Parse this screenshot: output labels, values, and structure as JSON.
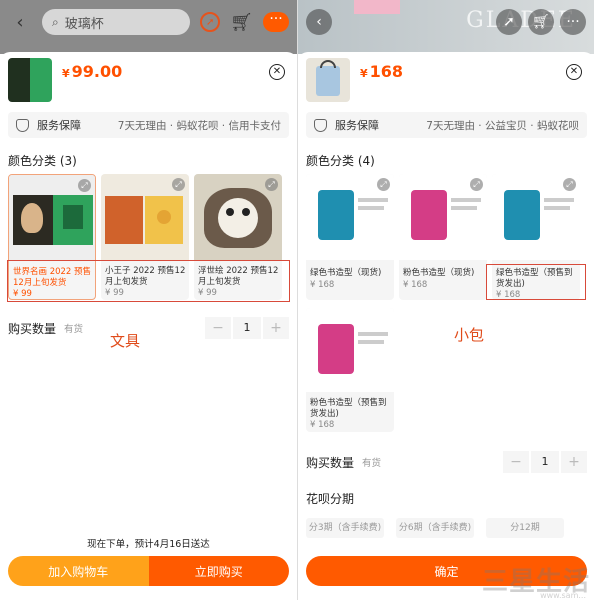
{
  "left": {
    "search_text": "玻璃杯",
    "price_symbol": "¥",
    "price": "99.00",
    "service_label": "服务保障",
    "service_detail": "7天无理由 · 蚂蚁花呗 · 信用卡支付",
    "category_title": "颜色分类 (3)",
    "options": [
      {
        "name": "世界名画 2022 预售12月上旬发货",
        "price": "¥ 99",
        "selected": true
      },
      {
        "name": "小王子 2022 预售12月上旬发货",
        "price": "¥ 99",
        "selected": false
      },
      {
        "name": "浮世绘 2022 预售12月上旬发货",
        "price": "¥ 99",
        "selected": false
      }
    ],
    "qty_label": "购买数量",
    "stock": "有货",
    "qty_minus": "−",
    "qty_value": "1",
    "qty_plus": "+",
    "overlay_label": "文具",
    "delivery_text": "现在下单，预计4月16日送达",
    "add_cart_label": "加入购物车",
    "buy_now_label": "立即购买"
  },
  "right": {
    "banner_brand": "GLADEE",
    "price_symbol": "¥",
    "price": "168",
    "service_label": "服务保障",
    "service_detail": "7天无理由 · 公益宝贝 · 蚂蚁花呗",
    "category_title": "颜色分类 (4)",
    "options": [
      {
        "name": "绿色书造型（现货)",
        "price": "¥ 168",
        "selected": false,
        "color": "#1f8fb0"
      },
      {
        "name": "粉色书造型（现货)",
        "price": "¥ 168",
        "selected": false,
        "color": "#d43d86"
      },
      {
        "name": "绿色书造型（预售到货发出)",
        "price": "¥ 168",
        "selected": true,
        "color": "#1f8fb0"
      },
      {
        "name": "粉色书造型（预售到货发出)",
        "price": "¥ 168",
        "selected": false,
        "color": "#d43d86"
      }
    ],
    "qty_label": "购买数量",
    "stock": "有货",
    "qty_minus": "−",
    "qty_value": "1",
    "qty_plus": "+",
    "overlay_label": "小包",
    "installment_title": "花呗分期",
    "installments": [
      "分3期（含手续费)",
      "分6期（含手续费)",
      "分12期"
    ],
    "confirm_label": "确定",
    "watermark": "三星生活",
    "watermark_sub": "www.sam..."
  },
  "colors": {
    "accent": "#ff5000",
    "orange_btn": "#ffa21a",
    "red_box": "#d84a3a"
  }
}
